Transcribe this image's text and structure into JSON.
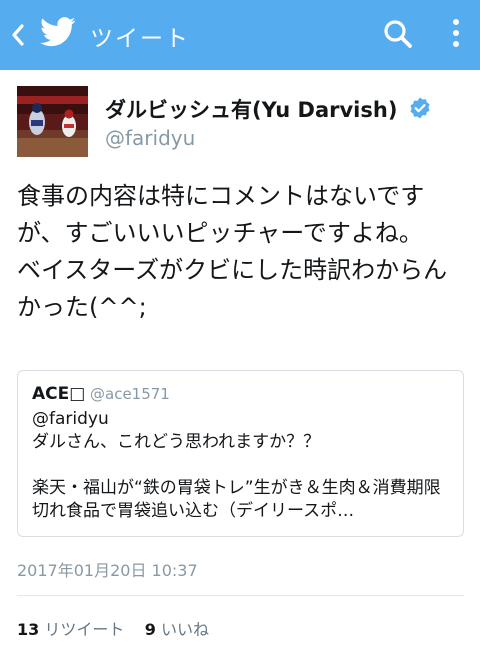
{
  "header": {
    "title": "ツイート",
    "accent_color": "#55acee",
    "icons": [
      "back-icon",
      "twitter-bird-icon",
      "search-icon",
      "more-vertical-icon"
    ]
  },
  "tweet": {
    "display_name": "ダルビッシュ有(Yu Darvish)",
    "handle": "@faridyu",
    "verified": true,
    "text": "食事の内容は特にコメントはないですが、すごいいいピッチャーですよね。\nベイスターズがクビにした時訳わからんかった(^^;",
    "quote": {
      "name": "ACE□",
      "handle": "@ace1571",
      "text": "@faridyu\nダルさん、これどう思われますか？？\n\n楽天・福山が“鉄の胃袋トレ”生がき＆生肉＆消費期限切れ食品で胃袋追い込む（デイリースポ…"
    },
    "timestamp": "2017年01月20日 10:37",
    "retweet_count": "13",
    "retweet_label": "リツイート",
    "like_count": "9",
    "like_label": "いいね"
  }
}
